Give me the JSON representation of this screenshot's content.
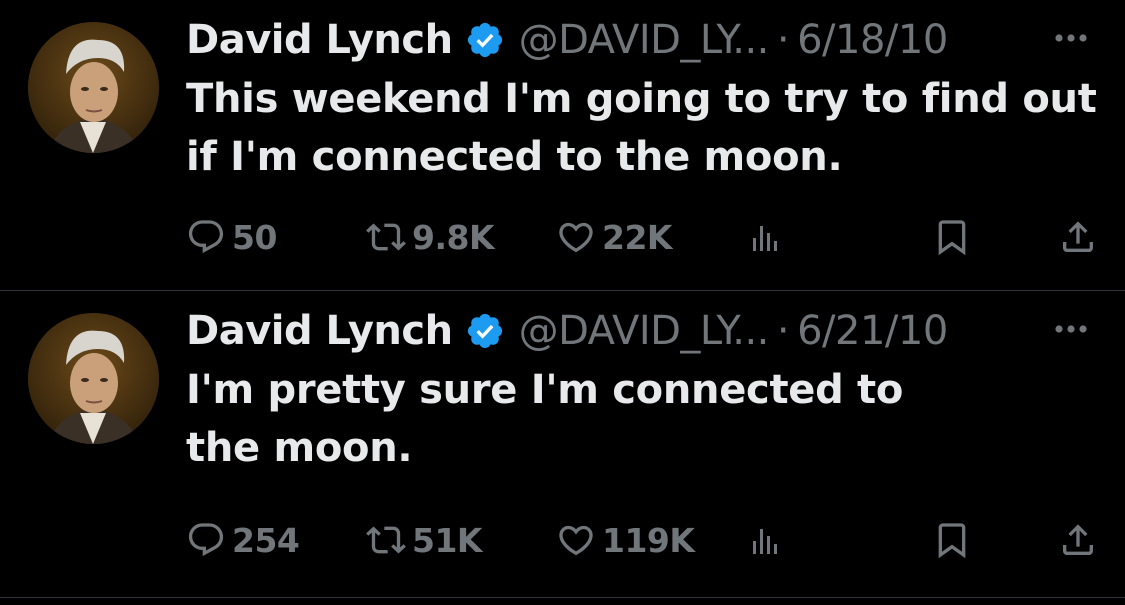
{
  "colors": {
    "background": "#000000",
    "primary_text": "#e7e9ea",
    "secondary_text": "#71767b",
    "verified_badge": "#1d9bf0",
    "divider": "#2f3336"
  },
  "tweets": [
    {
      "author_name": "David Lynch",
      "verified_icon": "verified-badge-icon",
      "handle": "@DAVID_LY...",
      "separator": "·",
      "date": "6/18/10",
      "text": "This weekend I'm going to try to find out if I'm connected to the moon.",
      "replies": "50",
      "retweets": "9.8K",
      "likes": "22K"
    },
    {
      "author_name": "David Lynch",
      "verified_icon": "verified-badge-icon",
      "handle": "@DAVID_LY...",
      "separator": "·",
      "date": "6/21/10",
      "text": "I'm pretty sure I'm connected to the moon.",
      "replies": "254",
      "retweets": "51K",
      "likes": "119K"
    }
  ]
}
